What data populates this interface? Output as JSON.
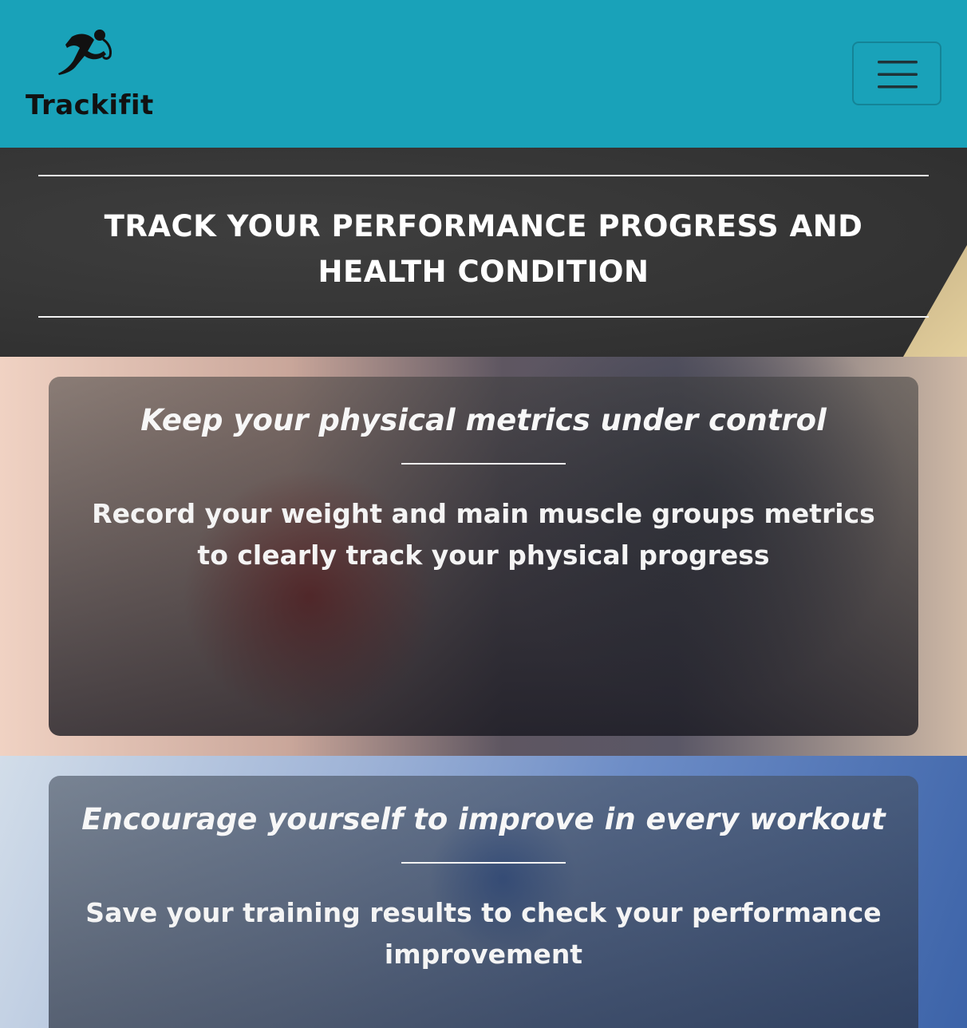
{
  "navbar": {
    "brand_name": "Trackifit",
    "logo_icon": "running-man-icon",
    "menu_icon": "hamburger-menu-icon",
    "bg_color": "#19a2b9"
  },
  "hero": {
    "title_line1": "TRACK YOUR PERFORMANCE PROGRESS AND",
    "title_line2": "HEALTH CONDITION"
  },
  "features": [
    {
      "title": "Keep your physical metrics under control",
      "text": "Record your weight and main muscle groups metrics to clearly track your physical progress"
    },
    {
      "title": "Encourage yourself to improve in every workout",
      "text": "Save your training results to check your performance improvement"
    }
  ]
}
